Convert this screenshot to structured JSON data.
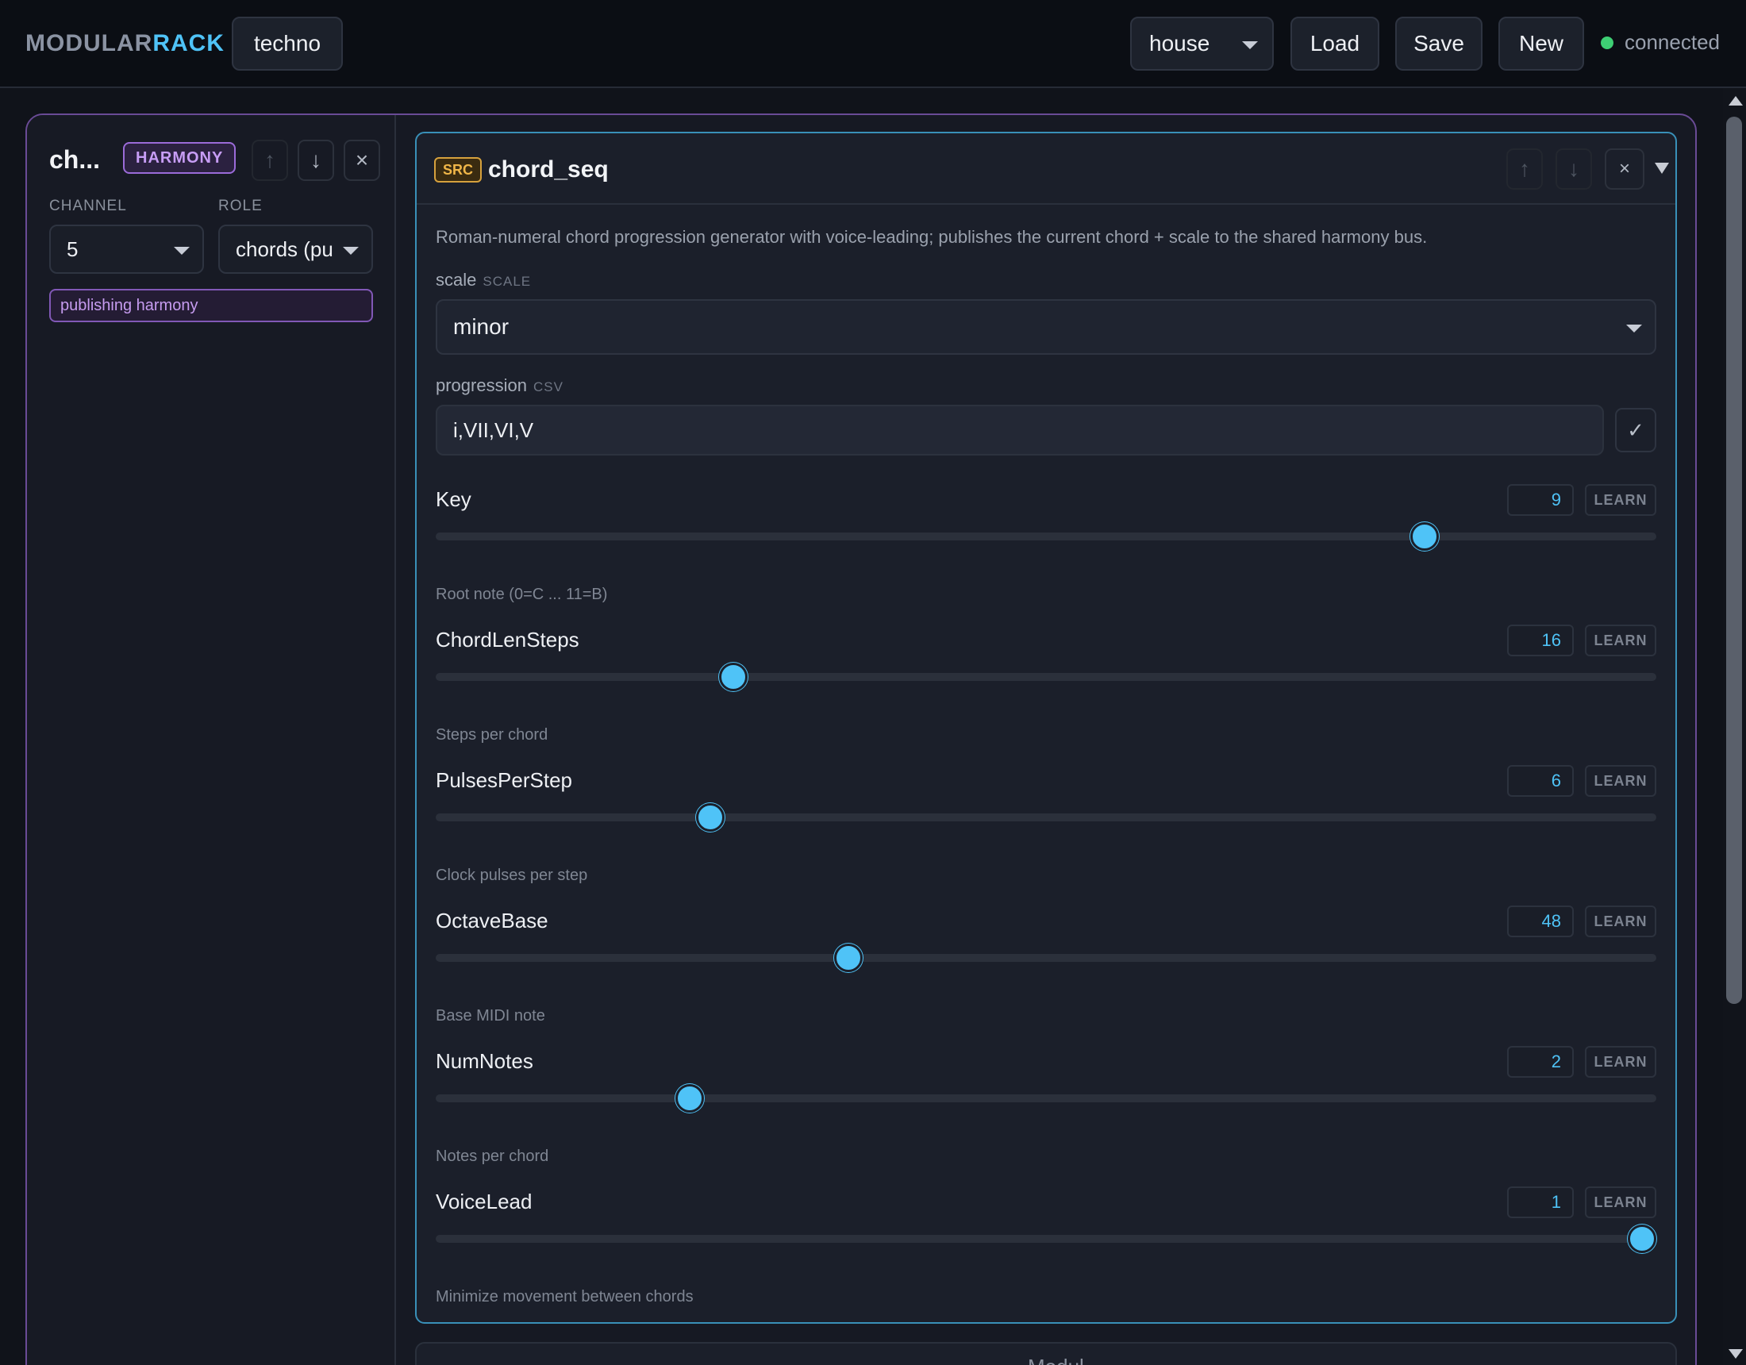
{
  "header": {
    "brand_part1": "MODULAR",
    "brand_part2": "RACK",
    "rack_name": "techno",
    "preset": "house",
    "load_label": "Load",
    "save_label": "Save",
    "new_label": "New",
    "status": "connected",
    "status_color": "#3ecf74"
  },
  "sidebar": {
    "title": "ch...",
    "badge": "HARMONY",
    "up_icon": "↑",
    "down_icon": "↓",
    "close_icon": "×",
    "channel_label": "CHANNEL",
    "channel_value": "5",
    "role_label": "ROLE",
    "role_value": "chords (pu",
    "publishing_badge": "publishing harmony"
  },
  "panel": {
    "src_badge": "SRC",
    "title": "chord_seq",
    "up_icon": "↑",
    "down_icon": "↓",
    "close_icon": "×",
    "description": "Roman-numeral chord progression generator with voice-leading; publishes the current chord + scale to the shared harmony bus.",
    "scale_label": "scale",
    "scale_hint": "SCALE",
    "scale_value": "minor",
    "progression_label": "progression",
    "progression_hint": "CSV",
    "progression_value": "i,VII,VI,V",
    "apply_icon": "✓",
    "learn_label": "LEARN",
    "params": [
      {
        "name": "Key",
        "value": "9",
        "fraction": 0.81,
        "desc": "Root note (0=C ... 11=B)"
      },
      {
        "name": "ChordLenSteps",
        "value": "16",
        "fraction": 0.244,
        "desc": "Steps per chord"
      },
      {
        "name": "PulsesPerStep",
        "value": "6",
        "fraction": 0.225,
        "desc": "Clock pulses per step"
      },
      {
        "name": "OctaveBase",
        "value": "48",
        "fraction": 0.338,
        "desc": "Base MIDI note"
      },
      {
        "name": "NumNotes",
        "value": "2",
        "fraction": 0.208,
        "desc": "Notes per chord"
      },
      {
        "name": "VoiceLead",
        "value": "1",
        "fraction": 0.988,
        "desc": "Minimize movement between chords"
      }
    ]
  },
  "next_module_label": "Modul",
  "accent_color": "#4fc3f7",
  "harmony_color": "#9b6bd9"
}
